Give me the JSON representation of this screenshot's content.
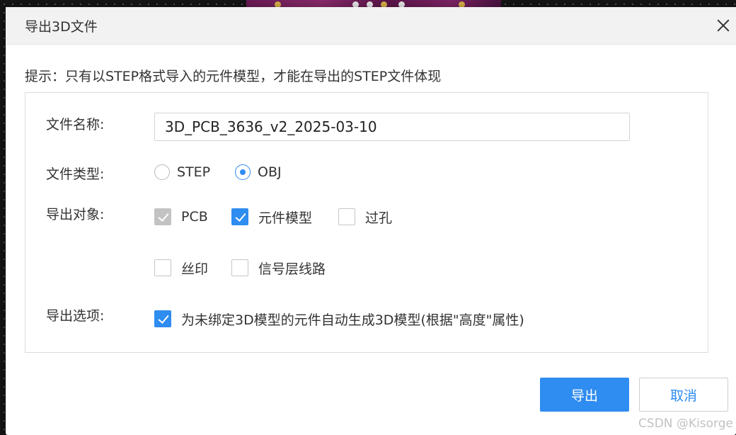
{
  "dialog": {
    "title": "导出3D文件",
    "close_icon": "close-icon"
  },
  "hint": "提示：只有以STEP格式导入的元件模型，才能在导出的STEP文件体现",
  "form": {
    "filename": {
      "label": "文件名称:",
      "value": "3D_PCB_3636_v2_2025-03-10"
    },
    "filetype": {
      "label": "文件类型:",
      "options": [
        {
          "label": "STEP",
          "selected": false
        },
        {
          "label": "OBJ",
          "selected": true
        }
      ]
    },
    "export_objects": {
      "label": "导出对象:",
      "items": [
        {
          "label": "PCB",
          "checked": true,
          "disabled": true
        },
        {
          "label": "元件模型",
          "checked": true,
          "disabled": false
        },
        {
          "label": "过孔",
          "checked": false,
          "disabled": false
        },
        {
          "label": "丝印",
          "checked": false,
          "disabled": false
        },
        {
          "label": "信号层线路",
          "checked": false,
          "disabled": false
        }
      ]
    },
    "export_options": {
      "label": "导出选项:",
      "items": [
        {
          "label": "为未绑定3D模型的元件自动生成3D模型(根据\"高度\"属性)",
          "checked": true
        }
      ]
    }
  },
  "buttons": {
    "export": "导出",
    "cancel": "取消"
  },
  "watermark": "CSDN @Kisorge",
  "colors": {
    "accent": "#2f8cf0",
    "disabled_check": "#c3c3c3",
    "title_bar": "#f2f2f2"
  }
}
